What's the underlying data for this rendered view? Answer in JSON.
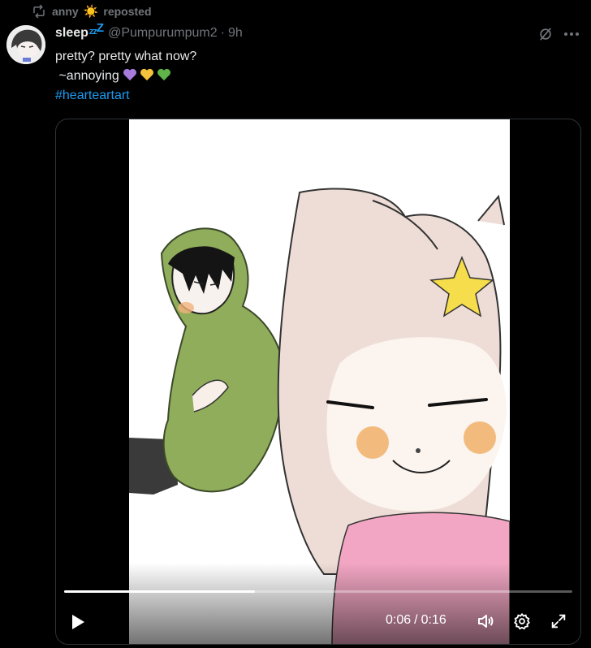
{
  "repost": {
    "name": "anny",
    "suffix": "reposted"
  },
  "author": {
    "display_name": "sleep",
    "handle": "@Pumpurumpum2",
    "time": "9h"
  },
  "tweet": {
    "line1": "pretty? pretty what now?",
    "line2": " ~annoying",
    "hashtag": "#hearteartart",
    "hearts": [
      "purple-heart-icon",
      "yellow-heart-icon",
      "green-heart-icon"
    ]
  },
  "video": {
    "current_time": "0:06",
    "separator": "/",
    "duration": "0:16",
    "progress_fraction": 0.375
  },
  "colors": {
    "accent": "#1d9bf0",
    "muted": "#71767b",
    "text": "#e7e9ea"
  }
}
